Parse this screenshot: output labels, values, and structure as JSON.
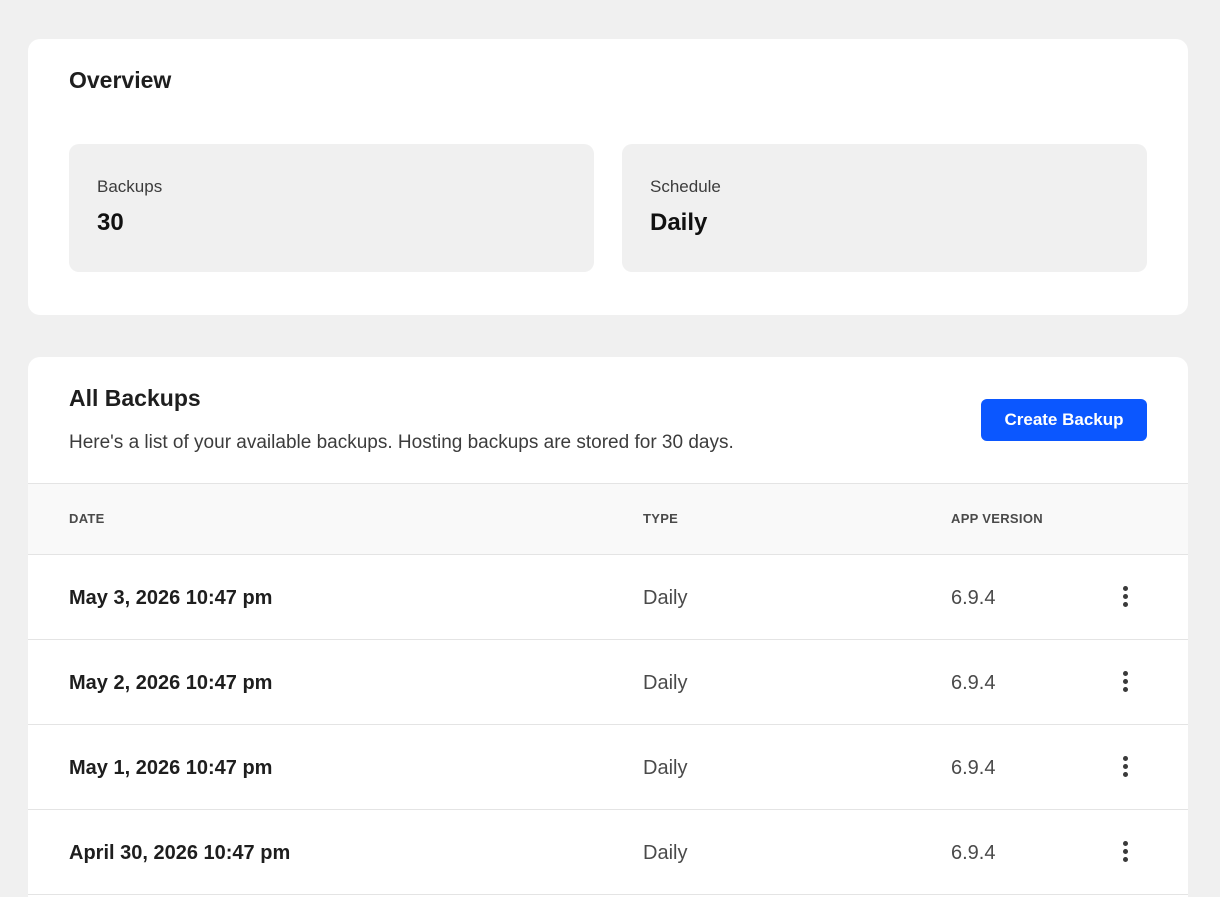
{
  "overview": {
    "title": "Overview",
    "stats": [
      {
        "label": "Backups",
        "value": "30"
      },
      {
        "label": "Schedule",
        "value": "Daily"
      }
    ]
  },
  "backups": {
    "title": "All Backups",
    "description": "Here's a list of your available backups. Hosting backups are stored for 30 days.",
    "create_label": "Create Backup",
    "columns": {
      "date": "DATE",
      "type": "TYPE",
      "version": "APP VERSION"
    },
    "rows": [
      {
        "date": "May 3, 2026 10:47 pm",
        "type": "Daily",
        "version": "6.9.4",
        "actions_icon": "more-vertical-icon"
      },
      {
        "date": "May 2, 2026 10:47 pm",
        "type": "Daily",
        "version": "6.9.4",
        "actions_icon": "more-vertical-icon"
      },
      {
        "date": "May 1, 2026 10:47 pm",
        "type": "Daily",
        "version": "6.9.4",
        "actions_icon": "more-vertical-icon"
      },
      {
        "date": "April 30, 2026 10:47 pm",
        "type": "Daily",
        "version": "6.9.4",
        "actions_icon": "more-vertical-icon"
      }
    ]
  },
  "colors": {
    "accent": "#0b57ff",
    "background": "#f0f0f0",
    "card": "#ffffff"
  }
}
